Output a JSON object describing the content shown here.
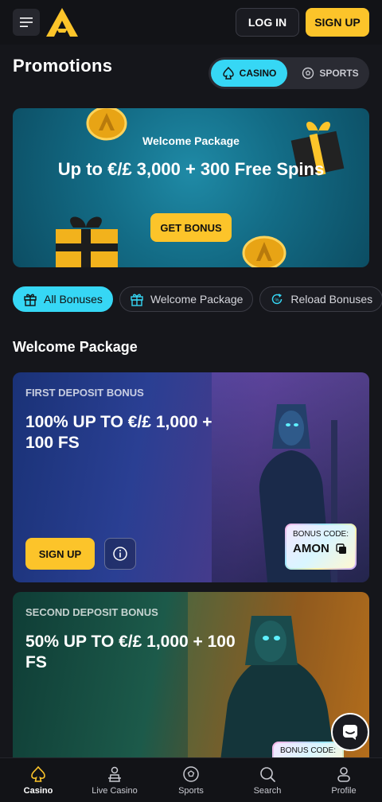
{
  "header": {
    "login_label": "LOG IN",
    "signup_label": "SIGN UP",
    "icons": {
      "menu": "menu-icon",
      "logo": "logo-icon"
    }
  },
  "page": {
    "title": "Promotions",
    "toggle": {
      "casino_label": "CASINO",
      "sports_label": "SPORTS",
      "active": "casino"
    }
  },
  "hero": {
    "subtitle": "Welcome Package",
    "title": "Up to €/£ 3,000 + 300 Free Spins",
    "button_label": "GET BONUS"
  },
  "filters": {
    "items": [
      {
        "label": "All Bonuses",
        "icon": "gift-icon",
        "active": true
      },
      {
        "label": "Welcome Package",
        "icon": "gift-box-icon",
        "active": false
      },
      {
        "label": "Reload Bonuses",
        "icon": "reload-icon",
        "active": false
      }
    ]
  },
  "section": {
    "title": "Welcome Package"
  },
  "cards": [
    {
      "label": "FIRST DEPOSIT BONUS",
      "title": "100% UP TO €/£ 1,000 + 100 FS",
      "signup_label": "SIGN UP",
      "code_label": "BONUS CODE:",
      "code_value": "AMON"
    },
    {
      "label": "SECOND DEPOSIT BONUS",
      "title": "50% UP TO €/£ 1,000 + 100 FS",
      "code_label": "BONUS CODE:"
    }
  ],
  "bottom_nav": {
    "items": [
      {
        "label": "Casino",
        "icon": "spade-icon",
        "active": true
      },
      {
        "label": "Live Casino",
        "icon": "dealer-icon",
        "active": false
      },
      {
        "label": "Sports",
        "icon": "soccer-ball-icon",
        "active": false
      },
      {
        "label": "Search",
        "icon": "search-icon",
        "active": false
      },
      {
        "label": "Profile",
        "icon": "user-icon",
        "active": false
      }
    ]
  },
  "colors": {
    "accent_yellow": "#fcc42a",
    "accent_cyan": "#36d7f5",
    "background": "#15161b"
  }
}
